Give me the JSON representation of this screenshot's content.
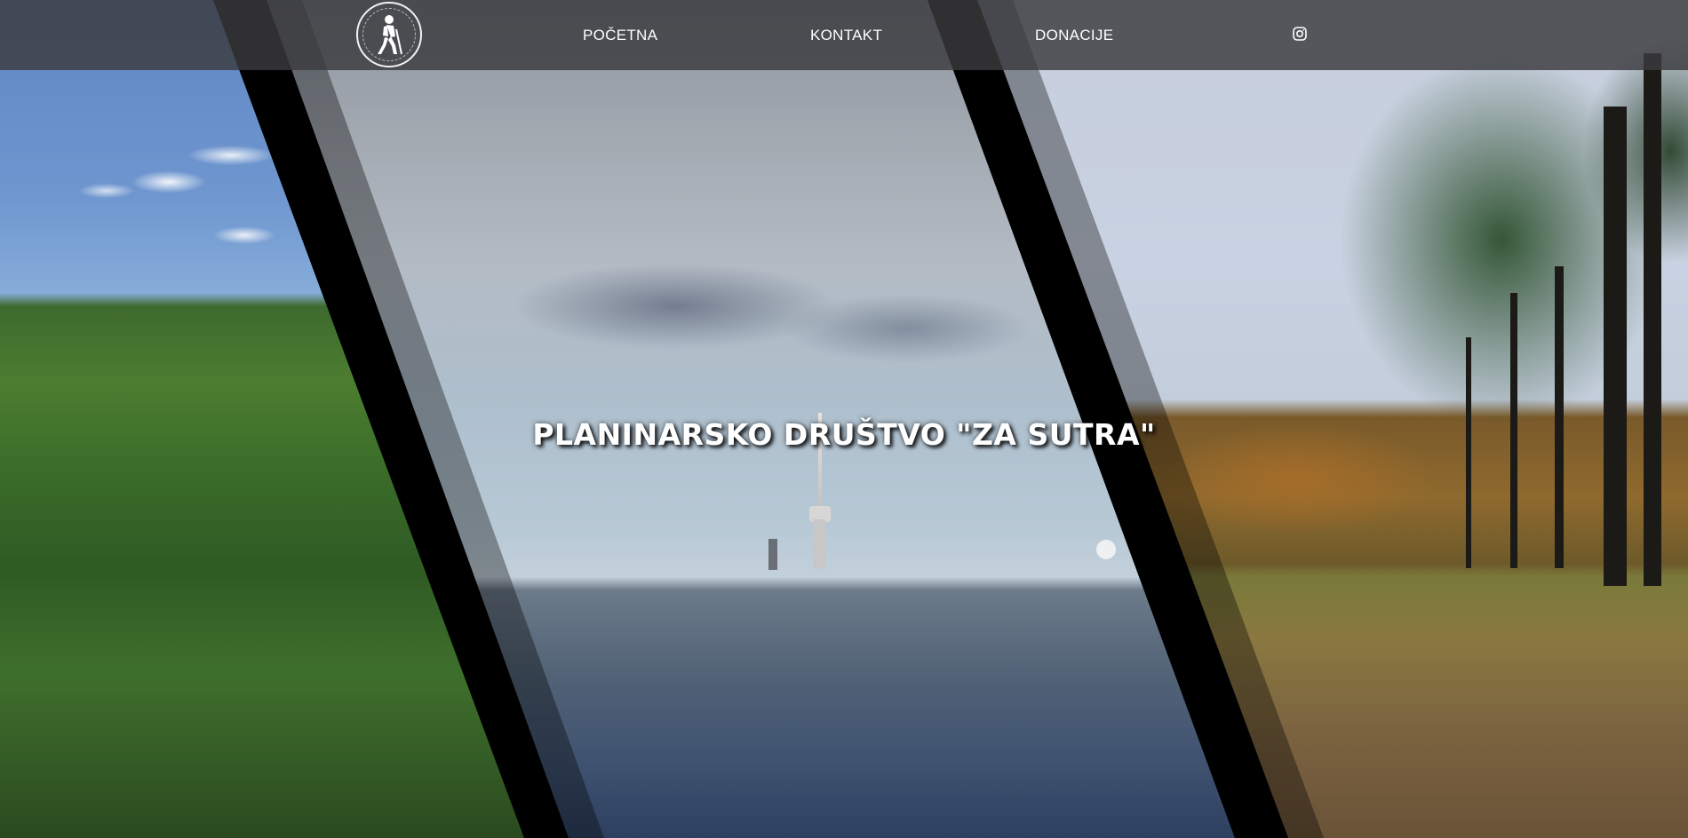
{
  "nav": {
    "logo_icon": "hiker-icon",
    "items": [
      {
        "label": "POČETNA"
      },
      {
        "label": "KONTAKT"
      },
      {
        "label": "DONACIJE"
      }
    ],
    "social_icon": "instagram-icon"
  },
  "hero": {
    "title": "PLANINARSKO DRUŠTVO \"ZA SUTRA\""
  },
  "colors": {
    "navbar_bg": "#3a3a3e",
    "nav_text": "#ffffff",
    "divider": "#000000"
  }
}
